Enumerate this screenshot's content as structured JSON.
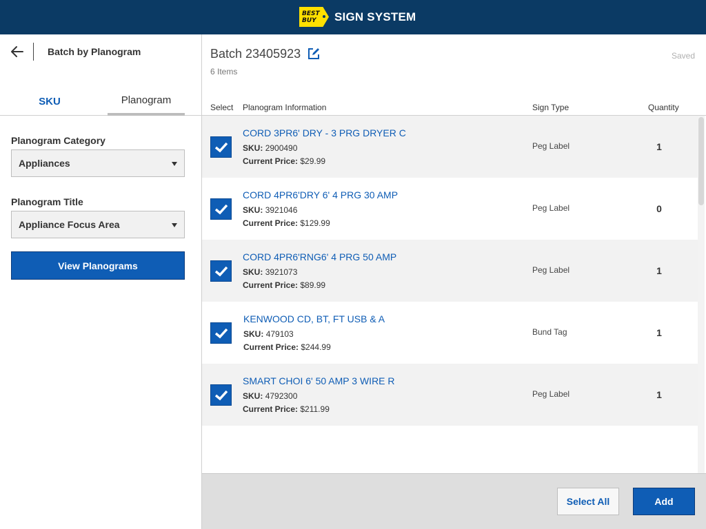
{
  "header": {
    "logo_line1": "BEST",
    "logo_line2": "BUY",
    "app_title": "SIGN SYSTEM"
  },
  "left_panel": {
    "title": "Batch by Planogram",
    "tabs": [
      {
        "label": "SKU",
        "active": false
      },
      {
        "label": "Planogram",
        "active": true
      }
    ],
    "category_label": "Planogram Category",
    "category_value": "Appliances",
    "title_label": "Planogram Title",
    "title_value": "Appliance Focus Area",
    "view_button": "View Planograms"
  },
  "batch": {
    "title": "Batch 23405923",
    "items_count": "6 Items",
    "status": "Saved"
  },
  "table": {
    "headers": {
      "select": "Select",
      "info": "Planogram Information",
      "sign_type": "Sign Type",
      "quantity": "Quantity"
    },
    "sku_label": "SKU:",
    "price_label": "Current Price:",
    "rows": [
      {
        "name": "CORD 3PR6' DRY - 3 PRG DRYER C",
        "sku": "2900490",
        "price": "$29.99",
        "sign_type": "Peg Label",
        "quantity": "1",
        "checked": true
      },
      {
        "name": "CORD 4PR6'DRY 6' 4 PRG 30 AMP",
        "sku": "3921046",
        "price": "$129.99",
        "sign_type": "Peg Label",
        "quantity": "0",
        "checked": true
      },
      {
        "name": "CORD 4PR6'RNG6' 4 PRG 50 AMP",
        "sku": "3921073",
        "price": "$89.99",
        "sign_type": "Peg Label",
        "quantity": "1",
        "checked": true
      },
      {
        "name": "KENWOOD CD, BT, FT USB & A",
        "sku": "479103",
        "price": "$244.99",
        "sign_type": "Bund Tag",
        "quantity": "1",
        "checked": true
      },
      {
        "name": "SMART CHOI 6' 50 AMP 3 WIRE R",
        "sku": "4792300",
        "price": "$211.99",
        "sign_type": "Peg Label",
        "quantity": "1",
        "checked": true
      }
    ]
  },
  "footer": {
    "select_all": "Select All",
    "add": "Add"
  },
  "colors": {
    "header_bg": "#0b3a64",
    "accent": "#0f5db5",
    "logo_yellow": "#ffe000"
  }
}
